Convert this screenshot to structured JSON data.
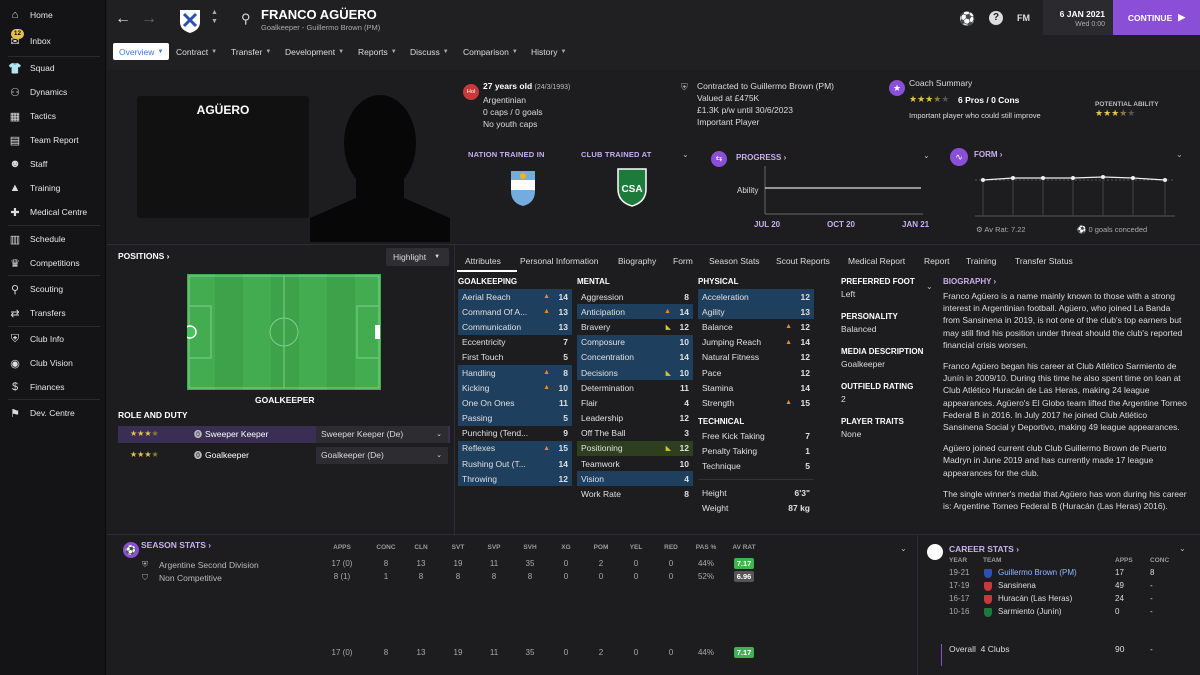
{
  "sidebar": {
    "items": [
      {
        "label": "Home",
        "icon": "home-icon"
      },
      {
        "label": "Inbox",
        "icon": "inbox-icon",
        "badge": "12"
      },
      {
        "label": "Squad",
        "icon": "squad-icon"
      },
      {
        "label": "Dynamics",
        "icon": "dynamics-icon"
      },
      {
        "label": "Tactics",
        "icon": "tactics-icon"
      },
      {
        "label": "Team Report",
        "icon": "team-report-icon"
      },
      {
        "label": "Staff",
        "icon": "staff-icon"
      },
      {
        "label": "Training",
        "icon": "training-icon"
      },
      {
        "label": "Medical Centre",
        "icon": "medical-icon"
      },
      {
        "label": "Schedule",
        "icon": "schedule-icon"
      },
      {
        "label": "Competitions",
        "icon": "trophy-icon"
      },
      {
        "label": "Scouting",
        "icon": "scouting-icon"
      },
      {
        "label": "Transfers",
        "icon": "transfers-icon"
      },
      {
        "label": "Club Info",
        "icon": "club-info-icon"
      },
      {
        "label": "Club Vision",
        "icon": "club-vision-icon"
      },
      {
        "label": "Finances",
        "icon": "finances-icon"
      },
      {
        "label": "Dev. Centre",
        "icon": "dev-centre-icon"
      }
    ]
  },
  "header": {
    "player_name": "FRANCO AGÜERO",
    "subtitle": "Goalkeeper - Guillermo Brown (PM)",
    "date": "6 JAN 2021",
    "time": "Wed 0:00",
    "fm_label": "FM",
    "continue_label": "CONTINUE"
  },
  "tabs": [
    "Overview",
    "Contract",
    "Transfer",
    "Development",
    "Reports",
    "Discuss",
    "Comparison",
    "History"
  ],
  "profile": {
    "card_name": "AGÜERO",
    "age": "27 years old",
    "dob": "(24/3/1993)",
    "nationality": "Argentinian",
    "caps": "0 caps / 0 goals",
    "youth": "No youth caps",
    "contract_line": "Contracted to Guillermo Brown (PM)",
    "value": "Valued at £475K",
    "wage": "£1.3K p/w until 30/6/2023",
    "status": "Important Player",
    "coach_title": "Coach Summary",
    "coach_pros": "6 Pros / 0 Cons",
    "coach_note": "Important player who could still improve",
    "potential_label": "POTENTIAL ABILITY",
    "current_stars": 3.5,
    "potential_stars": 3.5,
    "nation_trained": "NATION TRAINED IN",
    "club_trained": "CLUB TRAINED AT",
    "club_badge_text": "CSA",
    "hol_badge": "Hol"
  },
  "progress": {
    "title": "PROGRESS",
    "ylabel": "Ability",
    "xlabels": [
      "JUL 20",
      "OCT 20",
      "JAN 21"
    ]
  },
  "form": {
    "title": "FORM",
    "av_rat": "Av Rat: 7.22",
    "goals_conceded": "0 goals conceded"
  },
  "positions": {
    "title": "POSITIONS",
    "highlight": "Highlight",
    "position_label": "GOALKEEPER",
    "role_title": "ROLE AND DUTY",
    "roles": [
      {
        "name": "Sweeper Keeper",
        "select": "Sweeper Keeper (De)",
        "stars": 3.5
      },
      {
        "name": "Goalkeeper",
        "select": "Goalkeeper (De)",
        "stars": 3.5
      }
    ]
  },
  "subtabs": [
    "Attributes",
    "Personal Information",
    "Biography",
    "Form",
    "Season Stats",
    "Scout Reports",
    "Medical Report",
    "Report",
    "Training",
    "Transfer Status"
  ],
  "attributes": {
    "goalkeeping_title": "GOALKEEPING",
    "goalkeeping": [
      {
        "name": "Aerial Reach",
        "value": "14",
        "arrow": "up"
      },
      {
        "name": "Command Of A...",
        "value": "13",
        "arrow": "up"
      },
      {
        "name": "Communication",
        "value": "13",
        "arrow": ""
      },
      {
        "name": "Eccentricity",
        "value": "7",
        "arrow": ""
      },
      {
        "name": "First Touch",
        "value": "5",
        "arrow": ""
      },
      {
        "name": "Handling",
        "value": "8",
        "arrow": "up"
      },
      {
        "name": "Kicking",
        "value": "10",
        "arrow": "up"
      },
      {
        "name": "One On Ones",
        "value": "11",
        "arrow": ""
      },
      {
        "name": "Passing",
        "value": "5",
        "arrow": ""
      },
      {
        "name": "Punching (Tend...",
        "value": "9",
        "arrow": ""
      },
      {
        "name": "Reflexes",
        "value": "15",
        "arrow": "up"
      },
      {
        "name": "Rushing Out (T...",
        "value": "14",
        "arrow": ""
      },
      {
        "name": "Throwing",
        "value": "12",
        "arrow": ""
      }
    ],
    "mental_title": "MENTAL",
    "mental": [
      {
        "name": "Aggression",
        "value": "8",
        "arrow": ""
      },
      {
        "name": "Anticipation",
        "value": "14",
        "arrow": "up"
      },
      {
        "name": "Bravery",
        "value": "12",
        "arrow": "down"
      },
      {
        "name": "Composure",
        "value": "10",
        "arrow": ""
      },
      {
        "name": "Concentration",
        "value": "14",
        "arrow": ""
      },
      {
        "name": "Decisions",
        "value": "10",
        "arrow": "down"
      },
      {
        "name": "Determination",
        "value": "11",
        "arrow": ""
      },
      {
        "name": "Flair",
        "value": "4",
        "arrow": ""
      },
      {
        "name": "Leadership",
        "value": "12",
        "arrow": ""
      },
      {
        "name": "Off The Ball",
        "value": "3",
        "arrow": ""
      },
      {
        "name": "Positioning",
        "value": "12",
        "arrow": "down"
      },
      {
        "name": "Teamwork",
        "value": "10",
        "arrow": ""
      },
      {
        "name": "Vision",
        "value": "4",
        "arrow": ""
      },
      {
        "name": "Work Rate",
        "value": "8",
        "arrow": ""
      }
    ],
    "physical_title": "PHYSICAL",
    "physical": [
      {
        "name": "Acceleration",
        "value": "12",
        "arrow": ""
      },
      {
        "name": "Agility",
        "value": "13",
        "arrow": ""
      },
      {
        "name": "Balance",
        "value": "12",
        "arrow": "up"
      },
      {
        "name": "Jumping Reach",
        "value": "14",
        "arrow": "up"
      },
      {
        "name": "Natural Fitness",
        "value": "12",
        "arrow": ""
      },
      {
        "name": "Pace",
        "value": "12",
        "arrow": ""
      },
      {
        "name": "Stamina",
        "value": "14",
        "arrow": ""
      },
      {
        "name": "Strength",
        "value": "15",
        "arrow": "up"
      }
    ],
    "technical_title": "TECHNICAL",
    "technical": [
      {
        "name": "Free Kick Taking",
        "value": "7"
      },
      {
        "name": "Penalty Taking",
        "value": "1"
      },
      {
        "name": "Technique",
        "value": "5"
      }
    ],
    "height_label": "Height",
    "height": "6'3\"",
    "weight_label": "Weight",
    "weight": "87 kg"
  },
  "summary": {
    "foot_title": "PREFERRED FOOT",
    "foot": "Left",
    "personality_title": "PERSONALITY",
    "personality": "Balanced",
    "media_title": "MEDIA DESCRIPTION",
    "media": "Goalkeeper",
    "outfield_title": "OUTFIELD RATING",
    "outfield": "2",
    "traits_title": "PLAYER TRAITS",
    "traits": "None"
  },
  "biography": {
    "title": "BIOGRAPHY",
    "p1": "Franco Agüero is a name mainly known to those with a strong interest in Argentinian football. Agüero, who joined La Banda from Sansinena in 2019, is not one of the club's top earners but may still find his position under threat should the club's reported financial crisis worsen.",
    "p2": "Franco Agüero began his career at Club Atlético Sarmiento de Junín in 2009/10. During this time he also spent time on loan at Club Atlético Huracán de Las Heras, making 24 league appearances. Agüero's El Globo team lifted the Argentine Torneo Federal B in 2016. In July 2017 he joined Club Atlético Sansinena Social y Deportivo, making 49 league appearances.",
    "p3": "Agüero joined current club Club Guillermo Brown de Puerto Madryn in June 2019 and has currently made 17 league appearances for the club.",
    "p4": "The single winner's medal that Agüero has won during his career is: Argentine Torneo Federal B (Huracán (Las Heras) 2016)."
  },
  "season_stats": {
    "title": "SEASON STATS",
    "headers": [
      "APPS",
      "CONC",
      "CLN",
      "SVT",
      "SVP",
      "SVH",
      "XG",
      "POM",
      "YEL",
      "RED",
      "PAS %",
      "AV RAT"
    ],
    "rows": [
      {
        "comp": "Argentine Second Division",
        "values": [
          "17 (0)",
          "8",
          "13",
          "19",
          "11",
          "35",
          "0",
          "2",
          "0",
          "0",
          "44%",
          "7.17"
        ]
      },
      {
        "comp": "Non Competitive",
        "values": [
          "8 (1)",
          "1",
          "8",
          "8",
          "8",
          "8",
          "0",
          "0",
          "0",
          "0",
          "52%",
          "6.96"
        ]
      }
    ],
    "total": [
      "17 (0)",
      "8",
      "13",
      "19",
      "11",
      "35",
      "0",
      "2",
      "0",
      "0",
      "44%",
      "7.17"
    ]
  },
  "career_stats": {
    "title": "CAREER STATS",
    "headers": [
      "YEAR",
      "TEAM",
      "APPS",
      "CONC"
    ],
    "rows": [
      {
        "year": "19-21",
        "team": "Guillermo Brown (PM)",
        "apps": "17",
        "conc": "8"
      },
      {
        "year": "17-19",
        "team": "Sansinena",
        "apps": "49",
        "conc": "-"
      },
      {
        "year": "16-17",
        "team": "Huracán (Las Heras)",
        "apps": "24",
        "conc": "-"
      },
      {
        "year": "10-16",
        "team": "Sarmiento (Junín)",
        "apps": "0",
        "conc": "-"
      }
    ],
    "overall_label": "Overall",
    "overall_clubs": "4 Clubs",
    "overall_apps": "90",
    "overall_conc": "-"
  },
  "colors": {
    "accent": "#8a4fd6",
    "rating_green": "#3fb34f",
    "attr_highlight": "#1f3f5e"
  }
}
